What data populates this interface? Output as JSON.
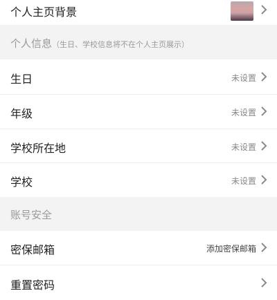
{
  "rows": {
    "bg": {
      "label": "个人主页背景"
    },
    "birthday": {
      "label": "生日",
      "value": "未设置"
    },
    "grade": {
      "label": "年级",
      "value": "未设置"
    },
    "school_location": {
      "label": "学校所在地",
      "value": "未设置"
    },
    "school": {
      "label": "学校",
      "value": "未设置"
    },
    "email": {
      "label": "密保邮箱",
      "value": "添加密保邮箱"
    },
    "reset_password": {
      "label": "重置密码"
    }
  },
  "sections": {
    "personal_info": {
      "title": "个人信息",
      "note": "（生日、学校信息将不在个人主页展示）"
    },
    "account_security": {
      "title": "账号安全"
    }
  }
}
